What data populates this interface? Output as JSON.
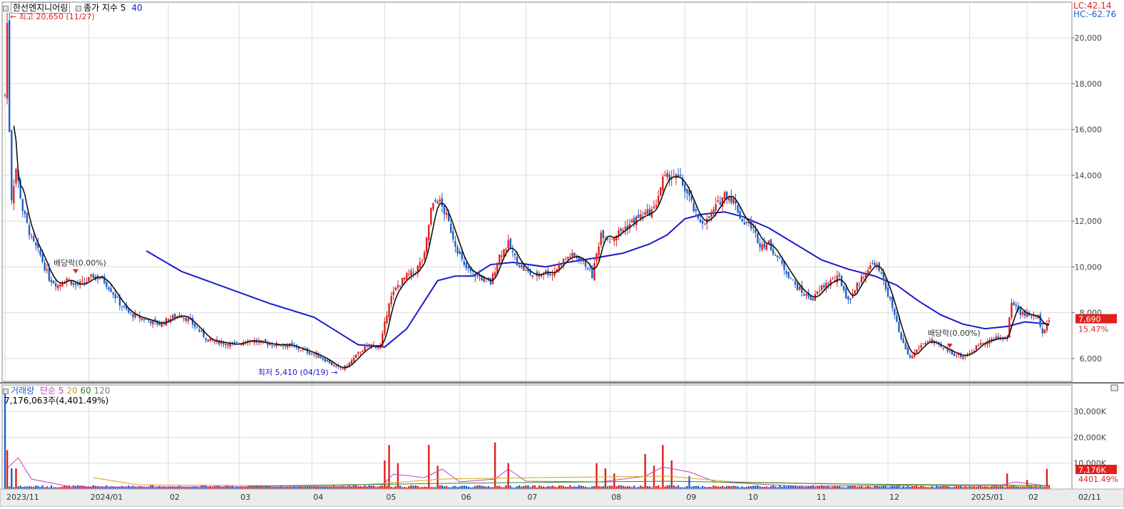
{
  "header": {
    "stock_name": "한선엔지니어링",
    "indicator_label": "종가 지수",
    "ma_periods": "5",
    "ma_periods_2": "40",
    "lc_text": "LC:42.14",
    "hc_text": "HC:-62.76"
  },
  "annotations": {
    "high_text": "최고 20,650 (11/27)",
    "low_text": "최저 5,410 (04/19)",
    "dividend_1": "배당락(0.00%)",
    "dividend_2": "배당락(0.00%)"
  },
  "price_axis": {
    "ticks": [
      "20,000",
      "18,000",
      "16,000",
      "14,000",
      "12,000",
      "10,000",
      "8,000",
      "6,000"
    ],
    "current_price": "7,690",
    "current_change": "15.47%"
  },
  "volume_panel": {
    "title": "거래량",
    "ma_label": "단순",
    "ma5": "5",
    "ma20": "20",
    "ma60": "60",
    "ma120": "120",
    "max_info": "7,176,063주(4,401.49%)",
    "ticks": [
      "30,000K",
      "20,000K",
      "10,000K"
    ],
    "current_volume": "7,176K",
    "current_pct": "4401.49%"
  },
  "x_axis": {
    "labels": [
      "2023/11",
      "2024/01",
      "02",
      "03",
      "04",
      "05",
      "06",
      "07",
      "08",
      "09",
      "10",
      "11",
      "12",
      "2025/01",
      "02",
      "02/11"
    ]
  },
  "colors": {
    "up": "#e0201c",
    "down": "#1f5fc8",
    "ma5": "#111111",
    "ma40": "#1a1ad0",
    "vol_ma5": "#c040c0",
    "vol_ma20": "#d8a020",
    "vol_ma60": "#2a8a2a",
    "vol_ma120": "#808080"
  },
  "chart_data": {
    "type": "candlestick",
    "y_range": [
      5000,
      21000
    ],
    "volume_range_k": [
      0,
      38000
    ],
    "price_ticks": [
      20000,
      18000,
      16000,
      14000,
      12000,
      10000,
      8000,
      6000
    ],
    "volume_ticks_k": [
      30000,
      20000,
      10000
    ],
    "high": {
      "value": 20650,
      "date": "11/27"
    },
    "low": {
      "value": 5410,
      "date": "04/19"
    },
    "last_close": 7690,
    "close_path": [
      [
        0,
        17500
      ],
      [
        1,
        20650
      ],
      [
        2,
        16000
      ],
      [
        3,
        13000
      ],
      [
        5,
        14300
      ],
      [
        8,
        12500
      ],
      [
        12,
        11200
      ],
      [
        16,
        10500
      ],
      [
        20,
        9500
      ],
      [
        24,
        9200
      ],
      [
        28,
        9500
      ],
      [
        32,
        9200
      ],
      [
        36,
        9300
      ],
      [
        40,
        9600
      ],
      [
        44,
        9500
      ],
      [
        48,
        9000
      ],
      [
        52,
        8400
      ],
      [
        56,
        8000
      ],
      [
        60,
        7800
      ],
      [
        64,
        7700
      ],
      [
        70,
        7500
      ],
      [
        76,
        7800
      ],
      [
        80,
        7900
      ],
      [
        84,
        7600
      ],
      [
        88,
        7200
      ],
      [
        92,
        6800
      ],
      [
        98,
        6700
      ],
      [
        104,
        6600
      ],
      [
        110,
        6800
      ],
      [
        116,
        6700
      ],
      [
        122,
        6600
      ],
      [
        128,
        6600
      ],
      [
        134,
        6400
      ],
      [
        140,
        6200
      ],
      [
        146,
        5900
      ],
      [
        150,
        5600
      ],
      [
        154,
        5600
      ],
      [
        158,
        6000
      ],
      [
        162,
        6400
      ],
      [
        166,
        6600
      ],
      [
        170,
        6500
      ],
      [
        172,
        7500
      ],
      [
        174,
        8500
      ],
      [
        178,
        9200
      ],
      [
        182,
        9600
      ],
      [
        186,
        9800
      ],
      [
        190,
        10500
      ],
      [
        193,
        12500
      ],
      [
        196,
        13000
      ],
      [
        200,
        12200
      ],
      [
        204,
        11000
      ],
      [
        208,
        10000
      ],
      [
        212,
        9700
      ],
      [
        216,
        9500
      ],
      [
        220,
        9300
      ],
      [
        224,
        10500
      ],
      [
        228,
        11000
      ],
      [
        232,
        10200
      ],
      [
        236,
        9800
      ],
      [
        240,
        9600
      ],
      [
        244,
        9800
      ],
      [
        248,
        9700
      ],
      [
        252,
        10200
      ],
      [
        256,
        10500
      ],
      [
        260,
        10400
      ],
      [
        264,
        10000
      ],
      [
        266,
        9600
      ],
      [
        270,
        11500
      ],
      [
        274,
        11200
      ],
      [
        278,
        11500
      ],
      [
        282,
        11800
      ],
      [
        286,
        12100
      ],
      [
        290,
        12300
      ],
      [
        294,
        12500
      ],
      [
        298,
        13800
      ],
      [
        302,
        14000
      ],
      [
        306,
        13800
      ],
      [
        310,
        13000
      ],
      [
        314,
        12000
      ],
      [
        318,
        12000
      ],
      [
        322,
        12600
      ],
      [
        326,
        13200
      ],
      [
        330,
        12900
      ],
      [
        334,
        12000
      ],
      [
        338,
        11800
      ],
      [
        342,
        11000
      ],
      [
        346,
        11000
      ],
      [
        350,
        10400
      ],
      [
        354,
        9800
      ],
      [
        358,
        9200
      ],
      [
        362,
        8800
      ],
      [
        366,
        8600
      ],
      [
        370,
        9100
      ],
      [
        374,
        9400
      ],
      [
        378,
        9500
      ],
      [
        382,
        8500
      ],
      [
        386,
        9200
      ],
      [
        390,
        9800
      ],
      [
        394,
        10200
      ],
      [
        398,
        9400
      ],
      [
        402,
        8200
      ],
      [
        406,
        6800
      ],
      [
        410,
        6000
      ],
      [
        414,
        6500
      ],
      [
        418,
        6800
      ],
      [
        422,
        6600
      ],
      [
        426,
        6400
      ],
      [
        430,
        6200
      ],
      [
        434,
        6100
      ],
      [
        438,
        6300
      ],
      [
        442,
        6700
      ],
      [
        446,
        6800
      ],
      [
        450,
        6900
      ],
      [
        454,
        6900
      ],
      [
        456,
        8500
      ],
      [
        460,
        8000
      ],
      [
        464,
        7900
      ],
      [
        468,
        7800
      ],
      [
        470,
        7200
      ],
      [
        473,
        7690
      ]
    ],
    "ma40_path": [
      [
        64,
        10700
      ],
      [
        80,
        9800
      ],
      [
        100,
        9100
      ],
      [
        120,
        8400
      ],
      [
        140,
        7800
      ],
      [
        150,
        7200
      ],
      [
        160,
        6600
      ],
      [
        172,
        6500
      ],
      [
        182,
        7300
      ],
      [
        190,
        8500
      ],
      [
        196,
        9400
      ],
      [
        204,
        9600
      ],
      [
        212,
        9600
      ],
      [
        220,
        10100
      ],
      [
        230,
        10200
      ],
      [
        245,
        10000
      ],
      [
        255,
        10200
      ],
      [
        268,
        10400
      ],
      [
        280,
        10600
      ],
      [
        292,
        11000
      ],
      [
        300,
        11400
      ],
      [
        308,
        12100
      ],
      [
        316,
        12300
      ],
      [
        326,
        12400
      ],
      [
        334,
        12200
      ],
      [
        346,
        11700
      ],
      [
        358,
        11000
      ],
      [
        370,
        10300
      ],
      [
        382,
        9900
      ],
      [
        394,
        9600
      ],
      [
        404,
        9200
      ],
      [
        414,
        8500
      ],
      [
        424,
        7900
      ],
      [
        434,
        7500
      ],
      [
        444,
        7300
      ],
      [
        454,
        7400
      ],
      [
        462,
        7600
      ],
      [
        473,
        7500
      ]
    ],
    "month_boundaries": [
      {
        "x": 0,
        "label": "2023/11"
      },
      {
        "x": 38,
        "label": "2024/01"
      },
      {
        "x": 74,
        "label": "02"
      },
      {
        "x": 106,
        "label": "03"
      },
      {
        "x": 139,
        "label": "04"
      },
      {
        "x": 172,
        "label": "05"
      },
      {
        "x": 206,
        "label": "06"
      },
      {
        "x": 236,
        "label": "07"
      },
      {
        "x": 274,
        "label": "08"
      },
      {
        "x": 308,
        "label": "09"
      },
      {
        "x": 336,
        "label": "10"
      },
      {
        "x": 367,
        "label": "11"
      },
      {
        "x": 400,
        "label": "12"
      },
      {
        "x": 437,
        "label": "2025/01"
      },
      {
        "x": 463,
        "label": "02"
      }
    ],
    "volume_spikes_k": [
      [
        0,
        37000
      ],
      [
        1,
        15000
      ],
      [
        3,
        8000
      ],
      [
        5,
        8000
      ],
      [
        172,
        11000
      ],
      [
        174,
        17000
      ],
      [
        178,
        10000
      ],
      [
        192,
        17000
      ],
      [
        196,
        9000
      ],
      [
        222,
        18000
      ],
      [
        228,
        10000
      ],
      [
        268,
        10000
      ],
      [
        272,
        8000
      ],
      [
        276,
        6000
      ],
      [
        290,
        13500
      ],
      [
        294,
        9000
      ],
      [
        298,
        17000
      ],
      [
        302,
        11000
      ],
      [
        310,
        5000
      ],
      [
        454,
        6000
      ],
      [
        463,
        3500
      ],
      [
        472,
        7800
      ]
    ]
  }
}
